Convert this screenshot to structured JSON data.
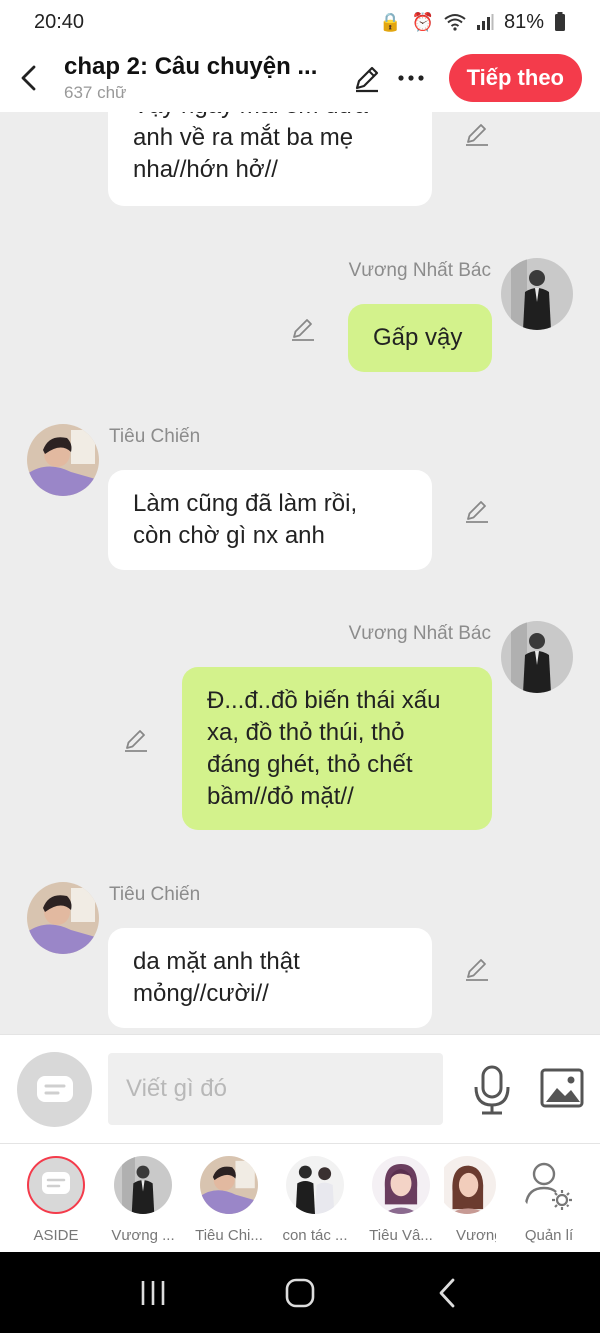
{
  "status": {
    "time": "20:40",
    "battery": "81%"
  },
  "header": {
    "title": "chap 2: Câu chuyện ...",
    "subtitle": "637 chữ",
    "next_label": "Tiếp theo"
  },
  "messages": [
    {
      "side": "left",
      "name": "",
      "lines": [
        "Vậy ngày mai em đưa",
        "anh về ra mắt ba mẹ",
        "nha//hớn hở//"
      ]
    },
    {
      "side": "right",
      "name": "Vương Nhất Bác",
      "lines": [
        "Gấp vậy"
      ]
    },
    {
      "side": "left",
      "name": "Tiêu Chiến",
      "lines": [
        "Làm cũng đã làm rồi,",
        "còn chờ gì nx anh"
      ]
    },
    {
      "side": "right",
      "name": "Vương Nhất Bác",
      "lines": [
        "Đ...đ..đồ biến thái xấu",
        "xa, đồ thỏ thúi, thỏ",
        "đáng ghét, thỏ chết",
        "bầm//đỏ mặt//"
      ]
    },
    {
      "side": "left",
      "name": "Tiêu Chiến",
      "lines": [
        "da mặt anh thật",
        "mỏng//cười//"
      ]
    }
  ],
  "input": {
    "placeholder": "Viết gì đó"
  },
  "characters": [
    {
      "label": "ASIDE"
    },
    {
      "label": "Vương ..."
    },
    {
      "label": "Tiêu Chi..."
    },
    {
      "label": "con tác ..."
    },
    {
      "label": "Tiêu Vâ..."
    },
    {
      "label": "Vương"
    },
    {
      "label": "Quản lí"
    }
  ],
  "colors": {
    "accent": "#f43b4b",
    "right_bubble": "#d3f28c",
    "left_bubble": "#ffffff",
    "background": "#ededed"
  }
}
